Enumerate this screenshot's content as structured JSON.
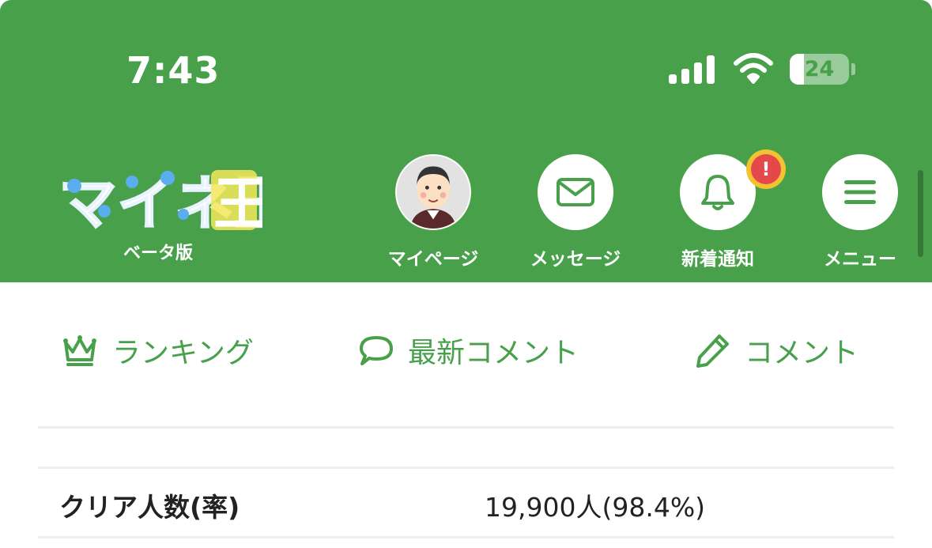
{
  "status_bar": {
    "time": "7:43",
    "battery_level": "24"
  },
  "header": {
    "logo_text": "マイネ王",
    "logo_subtitle": "ベータ版",
    "nav": [
      {
        "label": "マイページ",
        "icon": "avatar"
      },
      {
        "label": "メッセージ",
        "icon": "envelope-icon"
      },
      {
        "label": "新着通知",
        "icon": "bell-icon",
        "badge": "!"
      },
      {
        "label": "メニュー",
        "icon": "hamburger-menu-icon"
      }
    ]
  },
  "tabs": [
    {
      "label": "ランキング",
      "icon": "crown-icon"
    },
    {
      "label": "最新コメント",
      "icon": "speech-bubble-icon"
    },
    {
      "label": "コメント",
      "icon": "pencil-icon"
    }
  ],
  "stats": {
    "clear_label": "クリア人数(率)",
    "clear_value": "19,900人(98.4%)"
  },
  "colors": {
    "brand_green": "#48a04b",
    "badge_red": "#e4484b",
    "badge_ring": "#f2c232"
  }
}
